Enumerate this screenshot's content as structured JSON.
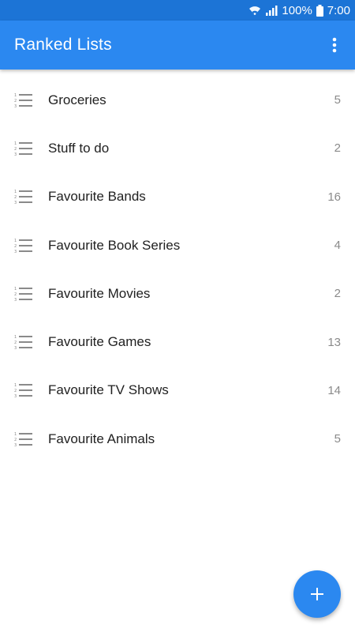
{
  "status_bar": {
    "battery_percent": "100%",
    "time": "7:00",
    "icons": [
      "wifi-icon",
      "signal-icon",
      "battery-icon"
    ]
  },
  "app_bar": {
    "title": "Ranked Lists",
    "menu_icon": "more-vert-icon"
  },
  "lists": [
    {
      "name": "Groceries",
      "count": "5",
      "icon": "numbered-list-icon"
    },
    {
      "name": "Stuff to do",
      "count": "2",
      "icon": "numbered-list-icon"
    },
    {
      "name": "Favourite Bands",
      "count": "16",
      "icon": "numbered-list-icon"
    },
    {
      "name": "Favourite Book Series",
      "count": "4",
      "icon": "numbered-list-icon"
    },
    {
      "name": "Favourite Movies",
      "count": "2",
      "icon": "numbered-list-icon"
    },
    {
      "name": "Favourite Games",
      "count": "13",
      "icon": "numbered-list-icon"
    },
    {
      "name": "Favourite TV Shows",
      "count": "14",
      "icon": "numbered-list-icon"
    },
    {
      "name": "Favourite Animals",
      "count": "5",
      "icon": "numbered-list-icon"
    }
  ],
  "fab": {
    "icon": "add-icon"
  },
  "colors": {
    "status_bar": "#1c74d6",
    "app_bar": "#2b88f0",
    "fab": "#2b88f0",
    "text_primary": "#212121",
    "text_secondary": "#8a8a8a"
  }
}
